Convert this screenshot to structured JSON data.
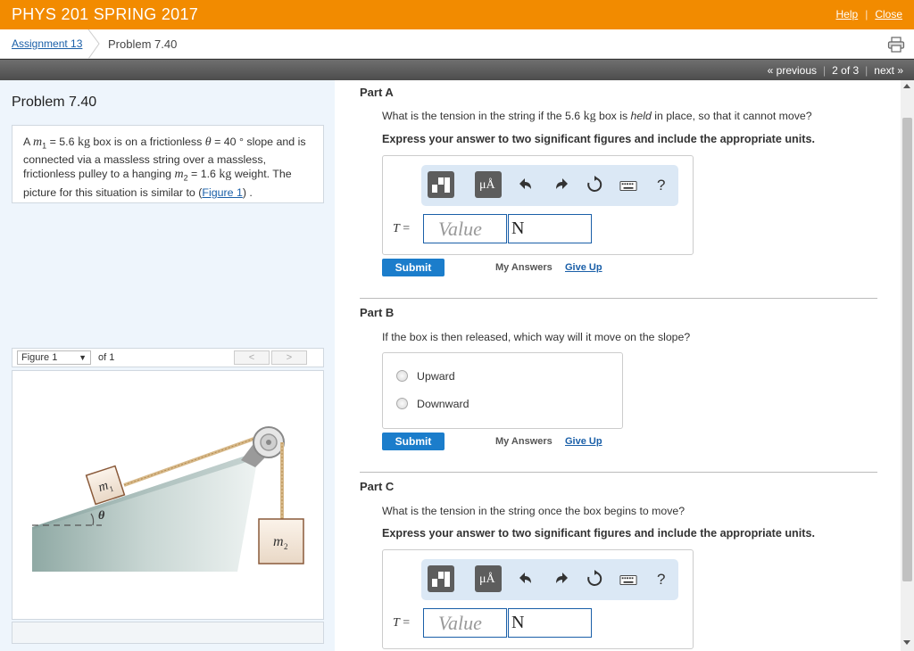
{
  "header": {
    "course_title": "PHYS 201 SPRING 2017",
    "help_label": "Help",
    "close_label": "Close"
  },
  "breadcrumb": {
    "assignment_link": "Assignment 13",
    "current": "Problem 7.40"
  },
  "nav": {
    "previous_label": "« previous",
    "position": "2 of 3",
    "next_label": "next »"
  },
  "problem": {
    "title": "Problem 7.40",
    "text_1": "A ",
    "m1_symbol": "m",
    "m1_sub": "1",
    "text_2": " = 5.6 ",
    "kg1": "kg",
    "text_3": " box is on a frictionless ",
    "theta": "θ",
    "text_4": " = 40 ° slope and is connected via a massless string over a massless, frictionless pulley to a hanging ",
    "m2_symbol": "m",
    "m2_sub": "2",
    "text_5": " = 1.6 ",
    "kg2": "kg",
    "text_6": " weight. The picture for this situation is similar to (",
    "figure_link": "Figure 1",
    "text_7": ") ."
  },
  "figure": {
    "select_value": "Figure 1",
    "of_text": "of 1",
    "prev_icon": "chevron-left-icon",
    "next_icon": "chevron-right-icon",
    "prev_glyph": "<",
    "next_glyph": ">",
    "m1_label": "m",
    "m1_sub": "1",
    "m2_label": "m",
    "m2_sub": "2",
    "theta_label": "θ"
  },
  "partA": {
    "title": "Part A",
    "q_1": "What is the tension in the string if the 5.6 ",
    "q_kg": "kg",
    "q_2": " box is ",
    "q_held": "held",
    "q_3": " in place, so that it cannot move?",
    "instruction": "Express your answer to two significant figures and include the appropriate units.",
    "var_label": "T",
    "var_eq": " =",
    "value_placeholder": "Value",
    "unit_value": "N",
    "submit_label": "Submit",
    "my_answers_label": "My Answers",
    "give_up_label": "Give Up"
  },
  "partB": {
    "title": "Part B",
    "question": "If the box is then released, which way will it move on the slope?",
    "options": [
      "Upward",
      "Downward"
    ],
    "submit_label": "Submit",
    "my_answers_label": "My Answers",
    "give_up_label": "Give Up"
  },
  "partC": {
    "title": "Part C",
    "question": "What is the tension in the string once the box begins to move?",
    "instruction": "Express your answer to two significant figures and include the appropriate units.",
    "var_label": "T",
    "var_eq": " =",
    "value_placeholder": "Value",
    "unit_value": "N"
  },
  "toolbar": {
    "units_label": "μÅ",
    "help_glyph": "?"
  },
  "colors": {
    "brand_orange": "#f28b00",
    "link_blue": "#1a5fa8",
    "submit_blue": "#1b7dcb"
  }
}
